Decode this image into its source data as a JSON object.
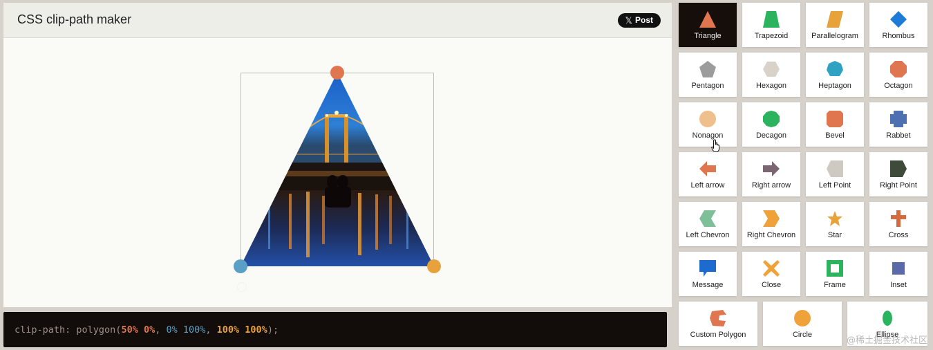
{
  "header": {
    "title": "CSS clip-path maker",
    "post_label": "Post",
    "post_icon": "x-logo-icon"
  },
  "code": {
    "property": "clip-path:",
    "func_open": " polygon(",
    "p1": "50% 0%",
    "sep1": ", ",
    "p2": "0% 100%",
    "sep2": ", ",
    "p3": "100% 100%",
    "close": ");"
  },
  "colors": {
    "handle_1": "#e0764f",
    "handle_2": "#5aa0c6",
    "handle_3": "#e7a23c",
    "active_tile": "#160e0b"
  },
  "shapes": {
    "triangle": "Triangle",
    "trapezoid": "Trapezoid",
    "parallelogram": "Parallelogram",
    "rhombus": "Rhombus",
    "pentagon": "Pentagon",
    "hexagon": "Hexagon",
    "heptagon": "Heptagon",
    "octagon": "Octagon",
    "nonagon": "Nonagon",
    "decagon": "Decagon",
    "bevel": "Bevel",
    "rabbet": "Rabbet",
    "left_arrow": "Left arrow",
    "right_arrow": "Right arrow",
    "left_point": "Left Point",
    "right_point": "Right Point",
    "left_chevron": "Left Chevron",
    "right_chevron": "Right Chevron",
    "star": "Star",
    "cross": "Cross",
    "message": "Message",
    "close": "Close",
    "frame": "Frame",
    "inset": "Inset",
    "custom_polygon": "Custom Polygon",
    "circle": "Circle",
    "ellipse": "Ellipse"
  },
  "selected_shape": "Triangle",
  "watermark": "@稀土掘金技术社区"
}
